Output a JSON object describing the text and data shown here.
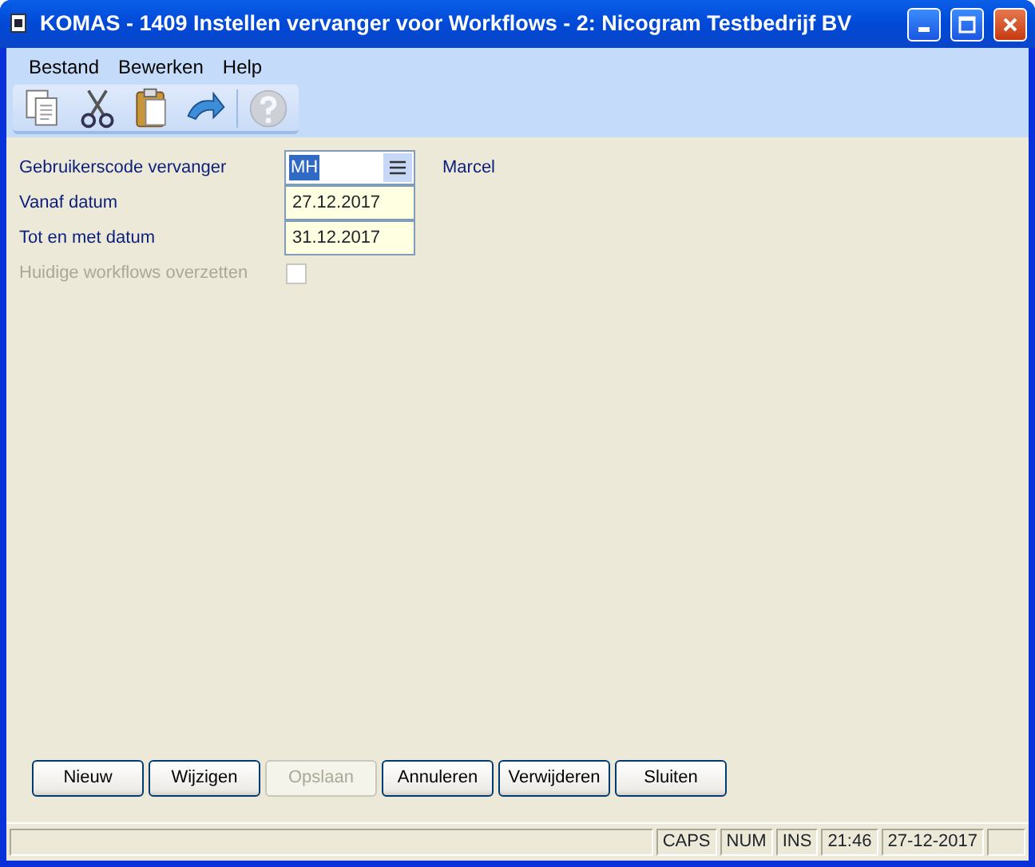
{
  "window": {
    "title": "KOMAS - 1409 Instellen vervanger voor Workflows - 2: Nicogram Testbedrijf BV"
  },
  "menu": [
    {
      "label": "Bestand"
    },
    {
      "label": "Bewerken"
    },
    {
      "label": "Help"
    }
  ],
  "toolbar": [
    {
      "kind": "copy",
      "disabled": false
    },
    {
      "kind": "cut",
      "disabled": false
    },
    {
      "kind": "paste",
      "disabled": false
    },
    {
      "kind": "undo",
      "disabled": false
    },
    {
      "kind": "sep"
    },
    {
      "kind": "help",
      "disabled": true
    }
  ],
  "form": [
    {
      "kind": "lookup",
      "label": "Gebruikerscode vervanger",
      "value": "MH",
      "selected": true,
      "name": "Marcel",
      "disabled": false
    },
    {
      "kind": "date",
      "label": "Vanaf datum",
      "value": "27.12.2017",
      "disabled": false
    },
    {
      "kind": "date",
      "label": "Tot en met datum",
      "value": "31.12.2017",
      "disabled": false
    },
    {
      "kind": "checkbox",
      "label": "Huidige workflows overzetten",
      "checked": false,
      "disabled": true
    }
  ],
  "buttons": [
    {
      "label": "Nieuw",
      "disabled": false
    },
    {
      "label": "Wijzigen",
      "disabled": false
    },
    {
      "label": "Opslaan",
      "disabled": true
    },
    {
      "label": "Annuleren",
      "disabled": false
    },
    {
      "label": "Verwijderen",
      "disabled": false
    },
    {
      "label": "Sluiten",
      "disabled": false
    }
  ],
  "status_bar": [
    "CAPS",
    "NUM",
    "INS",
    "21:46",
    "27-12-2017"
  ]
}
